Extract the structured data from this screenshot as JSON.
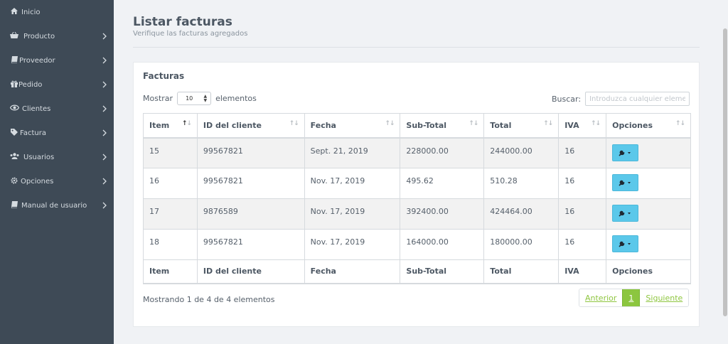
{
  "sidebar": {
    "items": [
      {
        "label": "Inicio",
        "icon": "home-icon",
        "has_arrow": false
      },
      {
        "label": "Producto",
        "icon": "basket-icon",
        "has_arrow": true
      },
      {
        "label": "Proveedor",
        "icon": "book-icon",
        "has_arrow": true
      },
      {
        "label": "Pedido",
        "icon": "gift-icon",
        "has_arrow": true
      },
      {
        "label": "Clientes",
        "icon": "eye-icon",
        "has_arrow": true
      },
      {
        "label": "Factura",
        "icon": "tag-icon",
        "has_arrow": true
      },
      {
        "label": "Usuarios",
        "icon": "users-icon",
        "has_arrow": true
      },
      {
        "label": "Opciones",
        "icon": "gear-icon",
        "has_arrow": true
      },
      {
        "label": "Manual de usuario",
        "icon": "book-icon",
        "has_arrow": true
      }
    ]
  },
  "header": {
    "title": "Listar facturas",
    "subtitle": "Verifique las facturas agregados"
  },
  "panel": {
    "title": "Facturas",
    "show_label_before": "Mostrar",
    "show_value": "10",
    "show_label_after": "elementos",
    "search_label": "Buscar:",
    "search_placeholder": "Introduzca cualquier elemento",
    "search_value": ""
  },
  "table": {
    "columns": [
      "Item",
      "ID del cliente",
      "Fecha",
      "Sub-Total",
      "Total",
      "IVA",
      "Opciones"
    ],
    "rows": [
      [
        "15",
        "99567821",
        "Sept. 21, 2019",
        "228000.00",
        "244000.00",
        "16"
      ],
      [
        "16",
        "99567821",
        "Nov. 17, 2019",
        "495.62",
        "510.28",
        "16"
      ],
      [
        "17",
        "9876589",
        "Nov. 17, 2019",
        "392400.00",
        "424464.00",
        "16"
      ],
      [
        "18",
        "99567821",
        "Nov. 17, 2019",
        "164000.00",
        "180000.00",
        "16"
      ]
    ],
    "sorted_column": "Item"
  },
  "footer": {
    "info": "Mostrando 1 de 4 de 4 elementos",
    "prev_label": "Anterior",
    "current_page": "1",
    "next_label": "Siguiente"
  },
  "colors": {
    "sidebar_bg": "#3e4a56",
    "options_button": "#5bc8ea",
    "pager_active": "#8cc63f"
  }
}
